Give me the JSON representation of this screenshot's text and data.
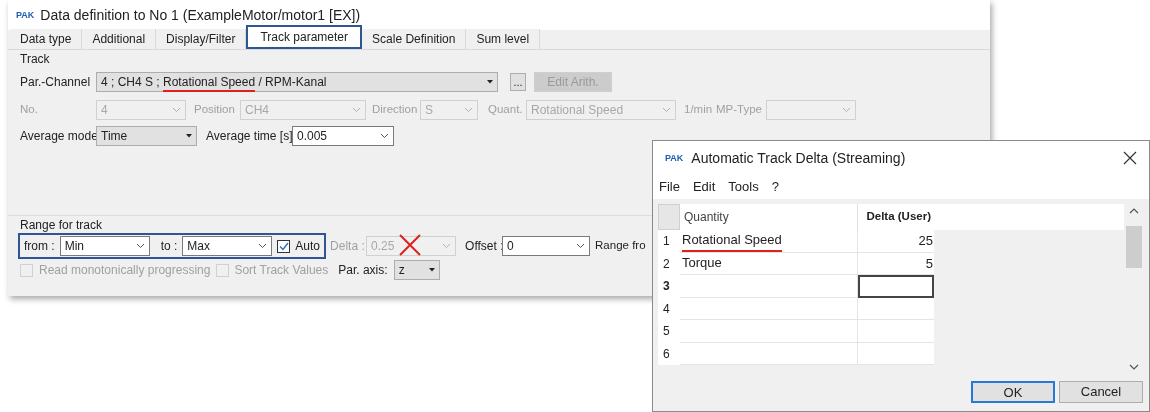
{
  "window": {
    "app_icon": "PAK",
    "title": "Data definition to No 1 (ExampleMotor/motor1 [EX])"
  },
  "tabs": [
    {
      "label": "Data type",
      "selected": false,
      "highlighted": false
    },
    {
      "label": "Additional",
      "selected": false,
      "highlighted": false
    },
    {
      "label": "Display/Filter",
      "selected": false,
      "highlighted": false
    },
    {
      "label": "Track parameter",
      "selected": true,
      "highlighted": true
    },
    {
      "label": "Scale Definition",
      "selected": false,
      "highlighted": false
    },
    {
      "label": "Sum level",
      "selected": false,
      "highlighted": false
    }
  ],
  "track": {
    "group_label": "Track",
    "par_channel": {
      "label": "Par.-Channel",
      "value_parts": [
        {
          "text": "4 ; CH4 S ; ",
          "underlined": false
        },
        {
          "text": "Rotational Speed",
          "underlined": true
        },
        {
          "text": " / RPM-Kanal",
          "underlined": false
        }
      ]
    },
    "browse_button": "...",
    "edit_button": {
      "label": "Edit Arith.",
      "disabled": true
    },
    "fields": [
      {
        "label": "No.",
        "value": "4",
        "disabled": true
      },
      {
        "label": "Position",
        "value": "CH4",
        "disabled": true
      },
      {
        "label": "Direction",
        "value": "S",
        "disabled": true
      },
      {
        "label": "Quant.",
        "value": "Rotational Speed",
        "disabled": true
      },
      {
        "label": "1/min",
        "disabled": true
      },
      {
        "label": "MP-Type",
        "disabled": true
      }
    ],
    "average_mode": {
      "label": "Average mode",
      "value": "Time"
    },
    "average_time": {
      "label": "Average time [s]",
      "value": "0.005"
    }
  },
  "range": {
    "group_label": "Range for track",
    "highlighted": true,
    "from": {
      "label": "from :",
      "value": "Min"
    },
    "to": {
      "label": "to :",
      "value": "Max"
    },
    "auto": {
      "label": "Auto",
      "checked": true
    },
    "delta": {
      "label": "Delta :",
      "value": "0.25",
      "disabled": true,
      "crossed": true
    },
    "offset": {
      "label": "Offset :",
      "value": "0"
    },
    "range_from_label": "Range fro",
    "read_monotonic": {
      "label": "Read monotonically progressing",
      "checked": false,
      "disabled": true
    },
    "sort_values": {
      "label": "Sort Track Values",
      "checked": false,
      "disabled": true
    },
    "par_axis": {
      "label": "Par. axis:",
      "value": "z"
    }
  },
  "dialog": {
    "app_icon": "PAK",
    "title": "Automatic Track Delta (Streaming)",
    "menu": [
      "File",
      "Edit",
      "Tools",
      "?"
    ],
    "columns": [
      "Quantity",
      "Delta (User)"
    ],
    "rows": [
      {
        "number": "1",
        "quantity": "Rotational Speed",
        "delta": "25",
        "underlined": true,
        "selected": false
      },
      {
        "number": "2",
        "quantity": "Torque",
        "delta": "5",
        "underlined": false,
        "selected": false
      },
      {
        "number": "3",
        "quantity": "",
        "delta": "",
        "underlined": false,
        "selected": true
      },
      {
        "number": "4",
        "quantity": "",
        "delta": "",
        "underlined": false,
        "selected": false
      },
      {
        "number": "5",
        "quantity": "",
        "delta": "",
        "underlined": false,
        "selected": false
      },
      {
        "number": "6",
        "quantity": "",
        "delta": "",
        "underlined": false,
        "selected": false
      }
    ],
    "buttons": [
      {
        "label": "OK",
        "default": true
      },
      {
        "label": "Cancel",
        "default": false
      }
    ]
  }
}
